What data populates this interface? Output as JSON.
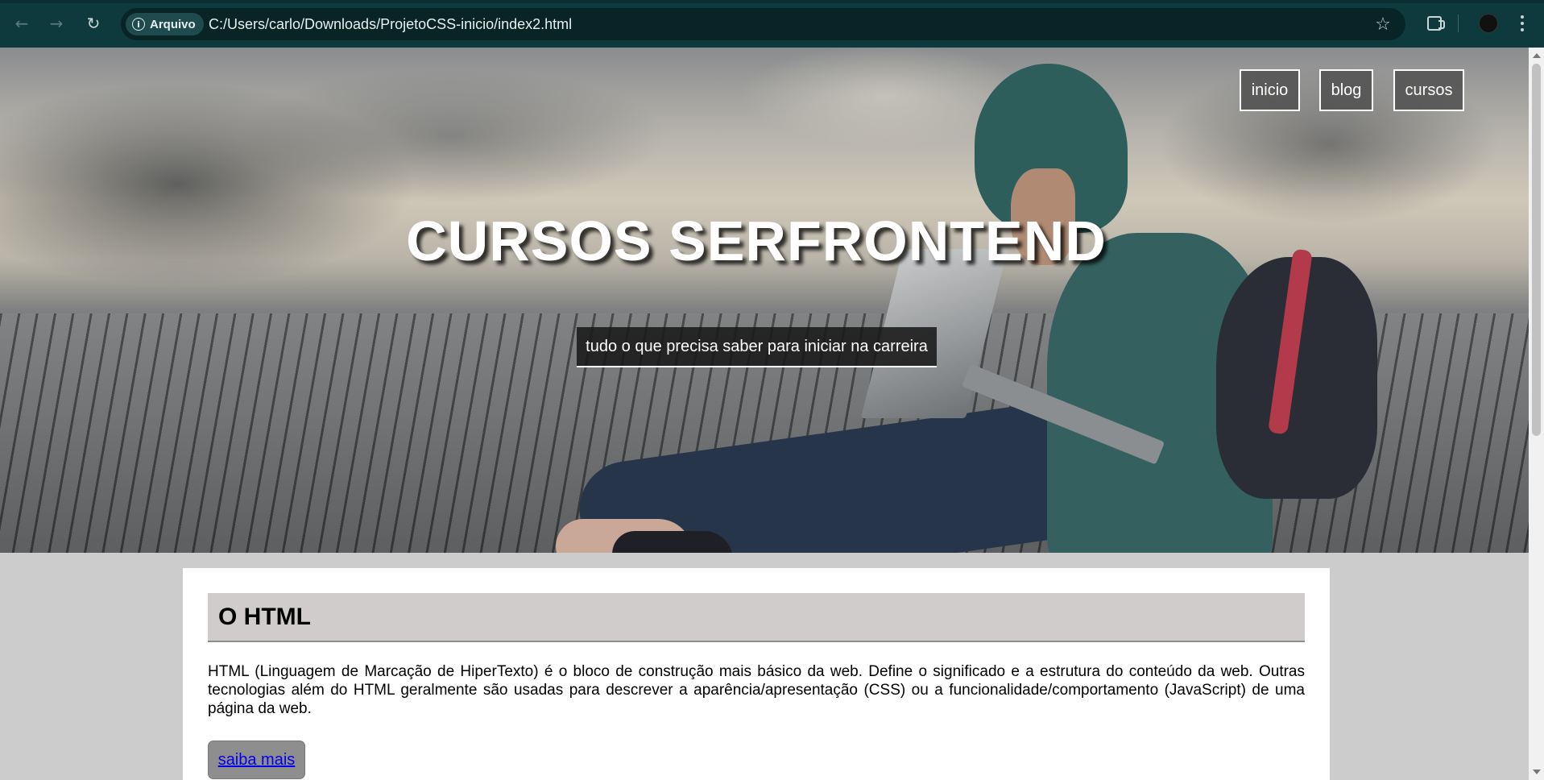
{
  "browser": {
    "back_icon": "arrow-left-icon",
    "forward_icon": "arrow-right-icon",
    "reload_icon": "reload-icon",
    "site_chip_label": "Arquivo",
    "url": "C:/Users/carlo/Downloads/ProjetoCSS-inicio/index2.html",
    "bookmark_icon": "star-icon",
    "extensions_icon": "puzzle-icon",
    "profile_icon": "avatar",
    "menu_icon": "kebab-menu-icon"
  },
  "hero": {
    "nav": [
      {
        "label": "inicio"
      },
      {
        "label": "blog"
      },
      {
        "label": "cursos"
      }
    ],
    "title": "CURSOS SERFRONTEND",
    "tagline": "tudo o que precisa saber para iniciar na carreira"
  },
  "section": {
    "heading": "O HTML",
    "body": "HTML (Linguagem de Marcação de HiperTexto) é o bloco de construção mais básico da web. Define o significado e a estrutura do conteúdo da web. Outras tecnologias além do HTML geralmente são usadas para descrever a aparência/apresentação (CSS) ou a funcionalidade/comportamento (JavaScript) de uma página da web.",
    "link_label": "saiba mais"
  },
  "colors": {
    "chrome_bg": "#0e3a3e",
    "page_bg": "#cccccc",
    "heading_bg": "#cfcccb",
    "button_bg": "#8e8e8e",
    "link": "#0000ee"
  }
}
